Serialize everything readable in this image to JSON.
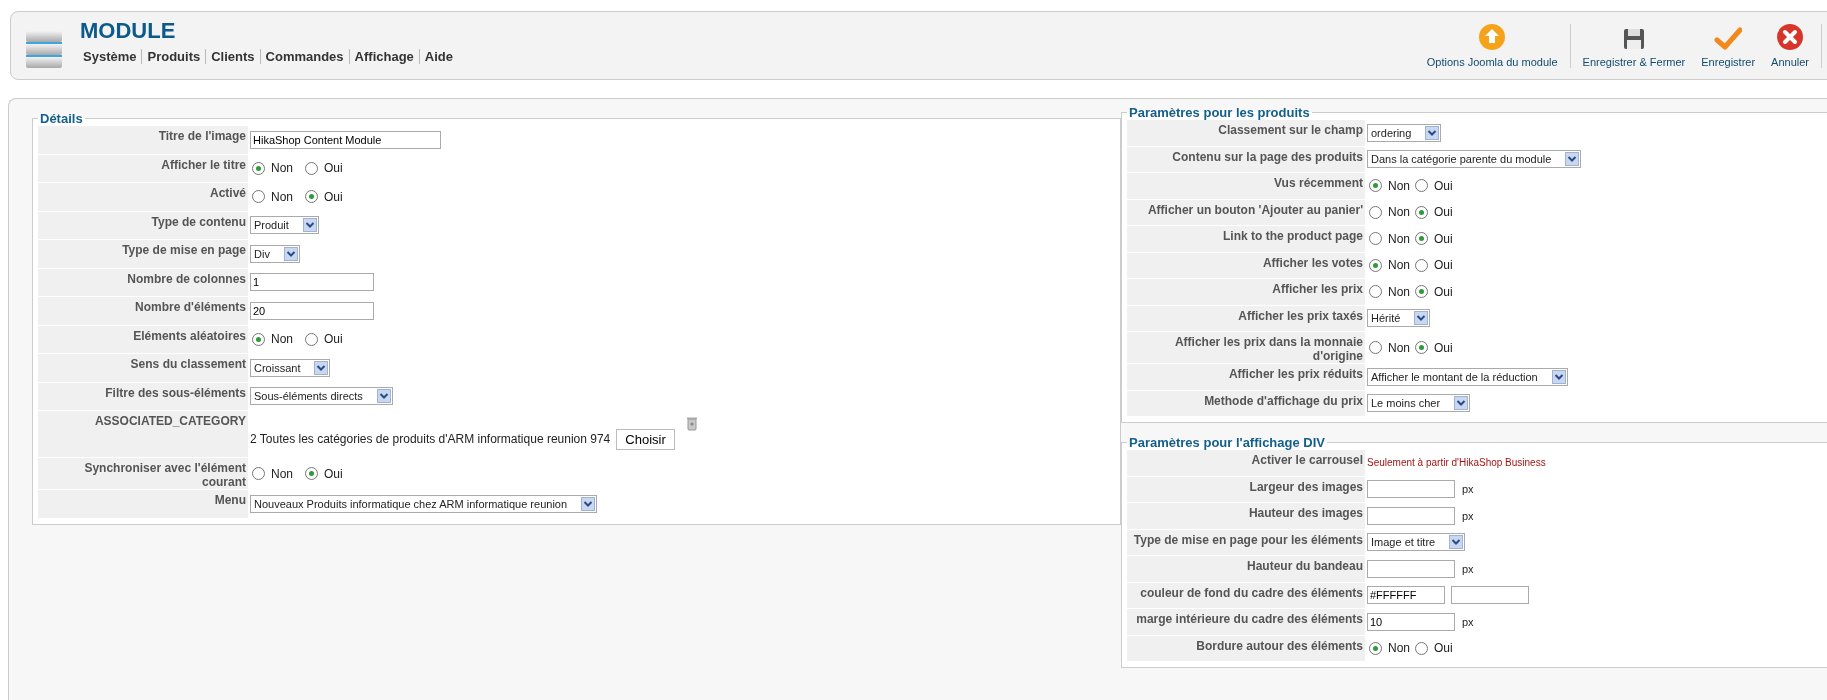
{
  "header": {
    "title": "MODULE",
    "menu": [
      "Système",
      "Produits",
      "Clients",
      "Commandes",
      "Affichage",
      "Aide"
    ]
  },
  "toolbar": [
    {
      "label": "Options Joomla du module",
      "kind": "options"
    },
    {
      "label": "Enregistrer & Fermer",
      "kind": "save-close"
    },
    {
      "label": "Enregistrer",
      "kind": "save"
    },
    {
      "label": "Annuler",
      "kind": "cancel"
    }
  ],
  "details": {
    "legend": "Détails",
    "rows": [
      {
        "label": "Titre de l'image",
        "kind": "text",
        "value": "HikaShop Content Module"
      },
      {
        "label": "Afficher le titre",
        "kind": "radio",
        "options": [
          {
            "label": "Non",
            "selected": true
          },
          {
            "label": "Oui",
            "selected": false
          }
        ]
      },
      {
        "label": "Activé",
        "kind": "radio",
        "options": [
          {
            "label": "Non",
            "selected": false
          },
          {
            "label": "Oui",
            "selected": true
          }
        ]
      },
      {
        "label": "Type de contenu",
        "kind": "select",
        "value": "Produit"
      },
      {
        "label": "Type de mise en page",
        "kind": "select",
        "value": "Div"
      },
      {
        "label": "Nombre de colonnes",
        "kind": "text",
        "value": "1"
      },
      {
        "label": "Nombre d'éléments",
        "kind": "text",
        "value": "20"
      },
      {
        "label": "Eléments aléatoires",
        "kind": "radio",
        "options": [
          {
            "label": "Non",
            "selected": true
          },
          {
            "label": "Oui",
            "selected": false
          }
        ]
      },
      {
        "label": "Sens du classement",
        "kind": "select",
        "value": "Croissant"
      },
      {
        "label": "Filtre des sous-éléments",
        "kind": "select",
        "value": "Sous-éléments directs"
      },
      {
        "label": "ASSOCIATED_CATEGORY",
        "kind": "category",
        "value": "2 Toutes les catégories de produits d'ARM informatique reunion 974",
        "button": "Choisir"
      },
      {
        "label": "Synchroniser avec l'élément courant",
        "kind": "radio",
        "options": [
          {
            "label": "Non",
            "selected": false
          },
          {
            "label": "Oui",
            "selected": true
          }
        ]
      },
      {
        "label": "Menu",
        "kind": "select",
        "value": "Nouveaux Produits informatique chez ARM informatique reunion"
      }
    ]
  },
  "product_params": {
    "legend": "Paramètres pour les produits",
    "rows": [
      {
        "label": "Classement sur le champ",
        "kind": "select",
        "value": "ordering"
      },
      {
        "label": "Contenu sur la page des produits",
        "kind": "select",
        "value": "Dans la catégorie parente du module"
      },
      {
        "label": "Vus récemment",
        "kind": "radio",
        "options": [
          {
            "label": "Non",
            "selected": true
          },
          {
            "label": "Oui",
            "selected": false
          }
        ]
      },
      {
        "label": "Afficher un bouton 'Ajouter au panier'",
        "kind": "radio",
        "options": [
          {
            "label": "Non",
            "selected": false
          },
          {
            "label": "Oui",
            "selected": true
          }
        ]
      },
      {
        "label": "Link to the product page",
        "kind": "radio",
        "options": [
          {
            "label": "Non",
            "selected": false
          },
          {
            "label": "Oui",
            "selected": true
          }
        ]
      },
      {
        "label": "Afficher les votes",
        "kind": "radio",
        "options": [
          {
            "label": "Non",
            "selected": true
          },
          {
            "label": "Oui",
            "selected": false
          }
        ]
      },
      {
        "label": "Afficher les prix",
        "kind": "radio",
        "options": [
          {
            "label": "Non",
            "selected": false
          },
          {
            "label": "Oui",
            "selected": true
          }
        ]
      },
      {
        "label": "Afficher les prix taxés",
        "kind": "select",
        "value": "Hérité"
      },
      {
        "label": "Afficher les prix dans la monnaie d'origine",
        "kind": "radio",
        "options": [
          {
            "label": "Non",
            "selected": false
          },
          {
            "label": "Oui",
            "selected": true
          }
        ]
      },
      {
        "label": "Afficher les prix réduits",
        "kind": "select",
        "value": "Afficher le montant de la réduction"
      },
      {
        "label": "Methode d'affichage du prix",
        "kind": "select",
        "value": "Le moins cher"
      }
    ]
  },
  "div_params": {
    "legend": "Paramètres pour l'affichage DIV",
    "rows": [
      {
        "label": "Activer le carrousel",
        "kind": "note",
        "value": "Seulement à partir d'HikaShop Business"
      },
      {
        "label": "Largeur des images",
        "kind": "text",
        "unit": "px"
      },
      {
        "label": "Hauteur des images",
        "kind": "text",
        "unit": "px"
      },
      {
        "label": "Type de mise en page pour les éléments",
        "kind": "select",
        "value": "Image et titre"
      },
      {
        "label": "Hauteur du bandeau",
        "kind": "text",
        "unit": "px"
      },
      {
        "label": "couleur de fond du cadre des éléments",
        "kind": "color",
        "value": "#FFFFFF"
      },
      {
        "label": "marge intérieure du cadre des éléments",
        "kind": "text",
        "value": "10",
        "unit": "px"
      },
      {
        "label": "Bordure autour des éléments",
        "kind": "radio",
        "options": [
          {
            "label": "Non",
            "selected": true
          },
          {
            "label": "Oui",
            "selected": false
          }
        ]
      }
    ]
  }
}
